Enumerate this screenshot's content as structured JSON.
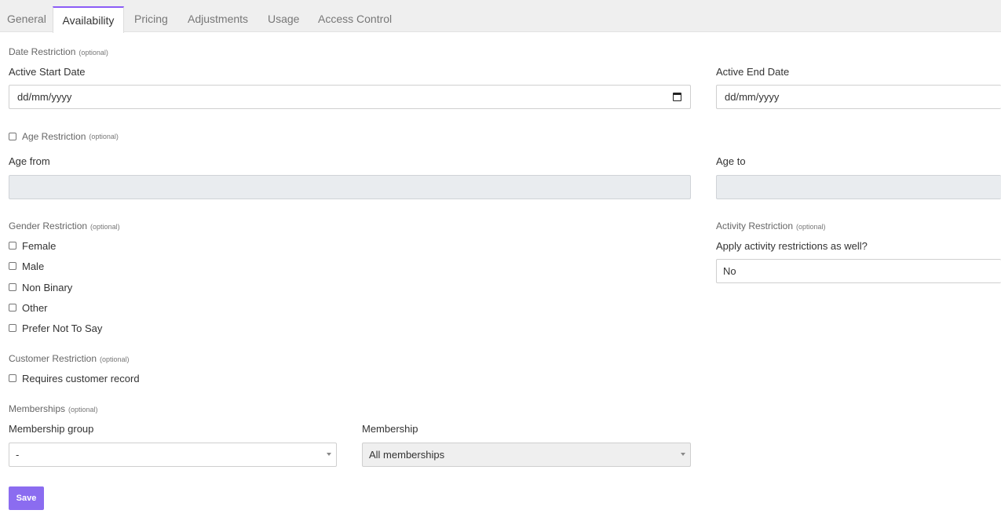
{
  "tabs": [
    {
      "label": "General"
    },
    {
      "label": "Availability"
    },
    {
      "label": "Pricing"
    },
    {
      "label": "Adjustments"
    },
    {
      "label": "Usage"
    },
    {
      "label": "Access Control"
    }
  ],
  "optional_text": "(optional)",
  "date_restriction": {
    "title": "Date Restriction",
    "start_label": "Active Start Date",
    "start_placeholder": "dd/mm/yyyy",
    "end_label": "Active End Date",
    "end_placeholder": "dd/mm/yyyy"
  },
  "age_restriction": {
    "title": "Age Restriction",
    "from_label": "Age from",
    "to_label": "Age to"
  },
  "gender_restriction": {
    "title": "Gender Restriction",
    "options": [
      "Female",
      "Male",
      "Non Binary",
      "Other",
      "Prefer Not To Say"
    ]
  },
  "activity_restriction": {
    "title": "Activity Restriction",
    "question": "Apply activity restrictions as well?",
    "value": "No"
  },
  "customer_restriction": {
    "title": "Customer Restriction",
    "checkbox_label": "Requires customer record"
  },
  "memberships": {
    "title": "Memberships",
    "group_label": "Membership group",
    "group_value": "-",
    "membership_label": "Membership",
    "membership_value": "All memberships"
  },
  "save_label": "Save",
  "colors": {
    "accent": "#8b5cf6",
    "button": "#8b6cf0",
    "tabbar_bg": "#efefef",
    "disabled_bg": "#e9ecef"
  }
}
